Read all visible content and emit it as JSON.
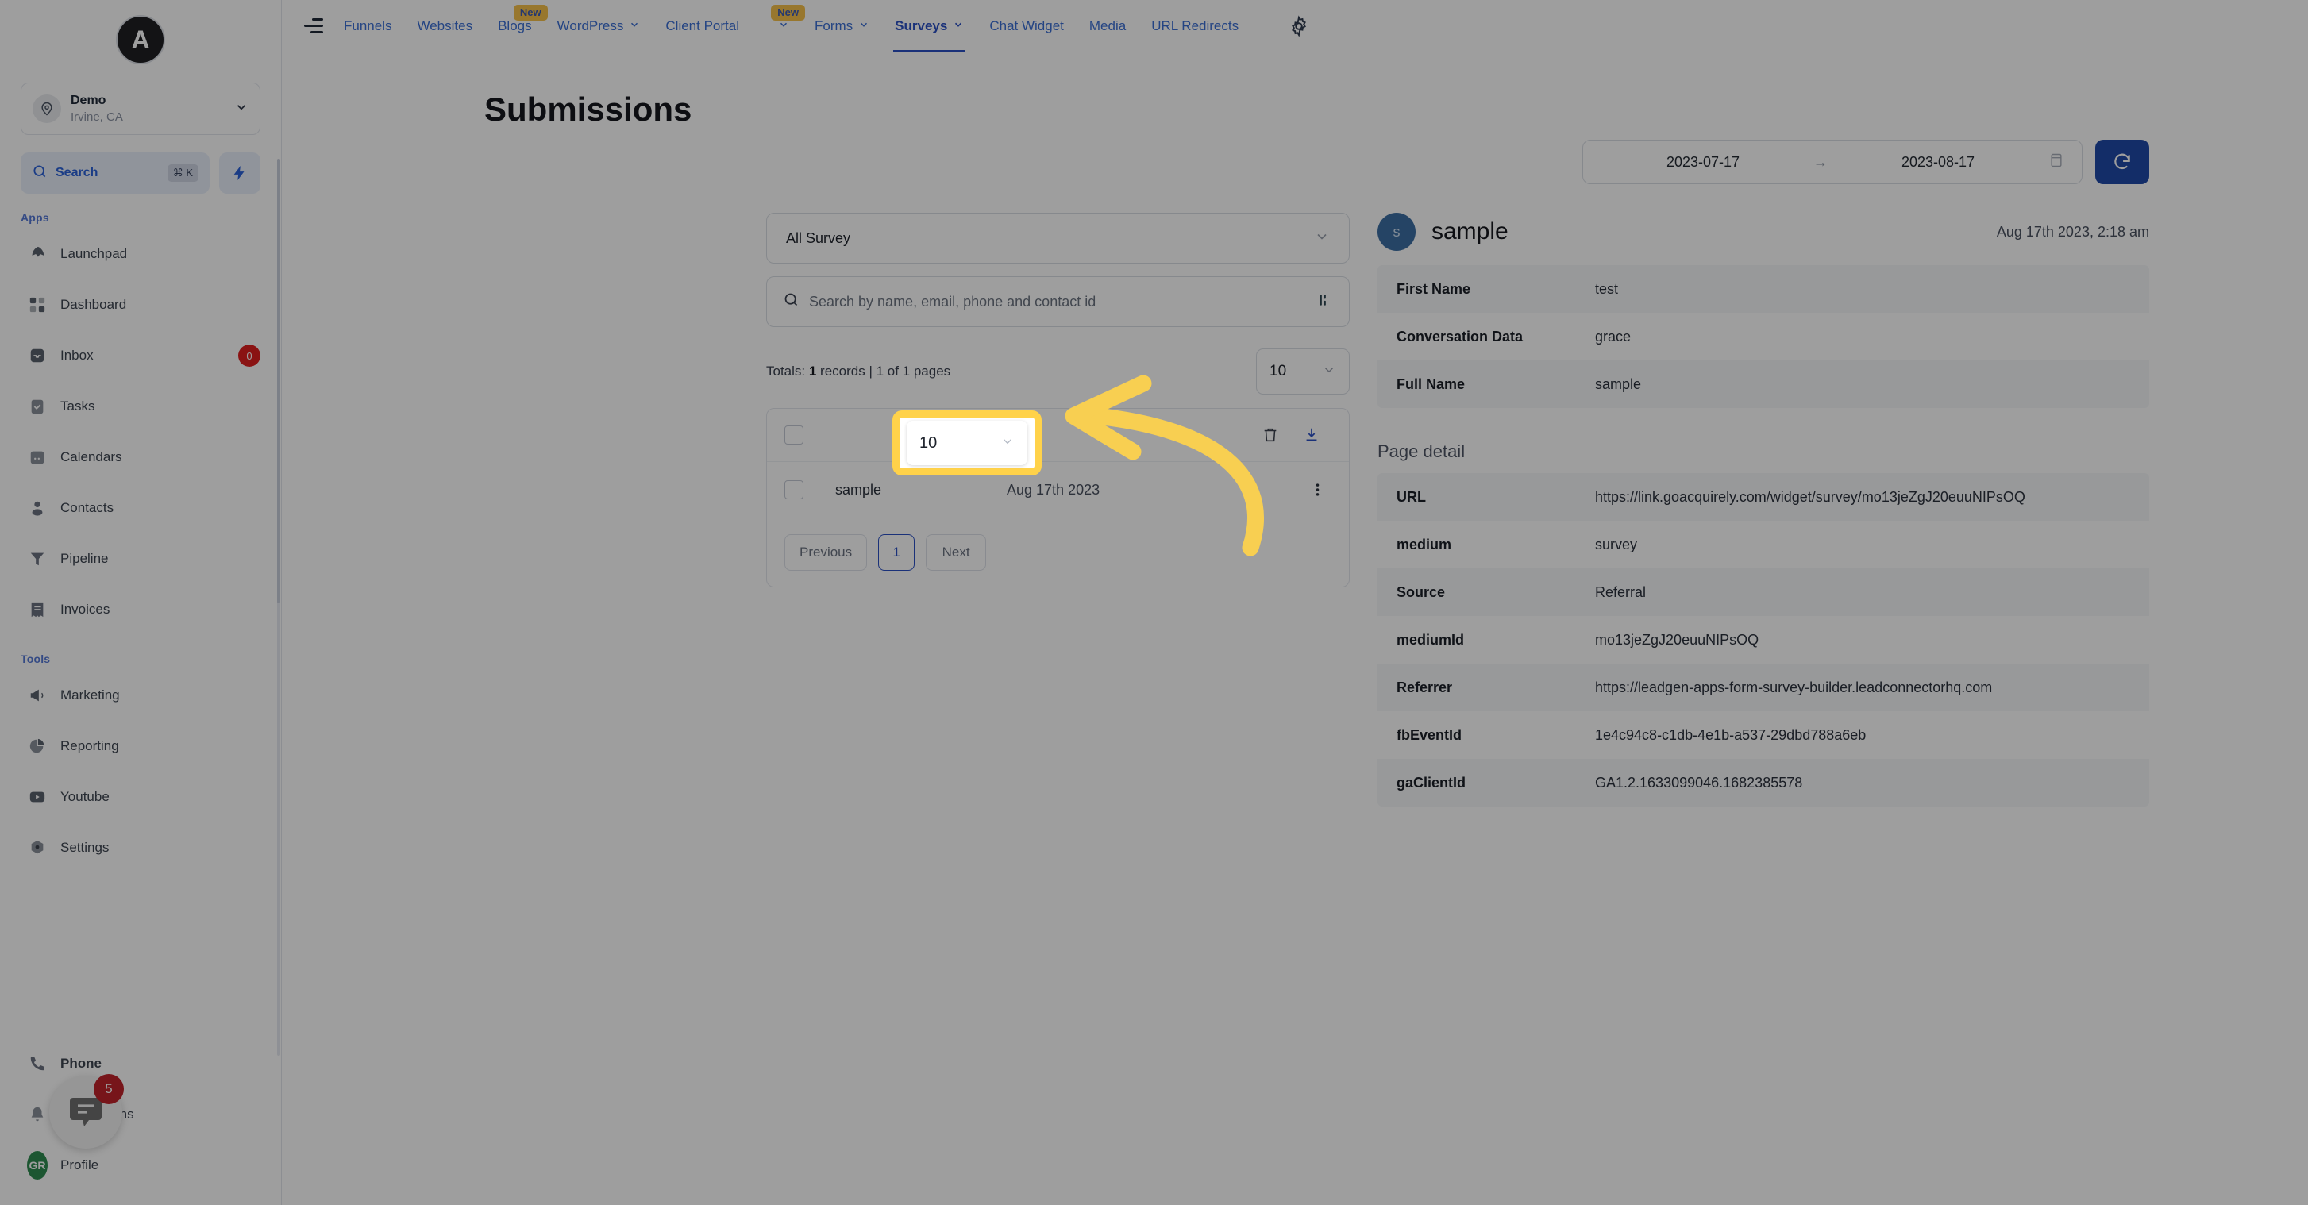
{
  "sidebar": {
    "logo_letter": "A",
    "location": {
      "name": "Demo",
      "sub": "Irvine, CA"
    },
    "search": {
      "label": "Search",
      "shortcut": "⌘ K"
    },
    "sections": [
      {
        "label": "Apps"
      },
      {
        "label": "Tools"
      }
    ],
    "apps_label": "Apps",
    "tools_label": "Tools",
    "apps": [
      {
        "label": "Launchpad",
        "icon": "rocket-icon",
        "badge": ""
      },
      {
        "label": "Dashboard",
        "icon": "grid-icon",
        "badge": ""
      },
      {
        "label": "Inbox",
        "icon": "inbox-icon",
        "badge": "0"
      },
      {
        "label": "Tasks",
        "icon": "clipboard-check-icon",
        "badge": ""
      },
      {
        "label": "Calendars",
        "icon": "calendar-icon",
        "badge": ""
      },
      {
        "label": "Contacts",
        "icon": "user-icon",
        "badge": ""
      },
      {
        "label": "Pipeline",
        "icon": "funnel-icon",
        "badge": ""
      },
      {
        "label": "Invoices",
        "icon": "invoice-icon",
        "badge": ""
      }
    ],
    "tools": [
      {
        "label": "Marketing",
        "icon": "megaphone-icon",
        "badge": ""
      },
      {
        "label": "Reporting",
        "icon": "pie-chart-icon",
        "badge": ""
      },
      {
        "label": "Youtube",
        "icon": "youtube-icon",
        "badge": ""
      },
      {
        "label": "Settings",
        "icon": "gear-icon",
        "badge": ""
      }
    ],
    "bottom": [
      {
        "label": "Phone",
        "icon": "phone-icon",
        "badge": ""
      },
      {
        "label": "Notifications",
        "icon": "bell-icon",
        "badge": ""
      },
      {
        "label": "Profile",
        "icon": "avatar-icon",
        "badge": "",
        "initials": "GR"
      }
    ]
  },
  "topnav": {
    "items": [
      {
        "label": "Funnels",
        "caret": false,
        "badge": "",
        "active": false
      },
      {
        "label": "Websites",
        "caret": false,
        "badge": "",
        "active": false
      },
      {
        "label": "Blogs",
        "caret": false,
        "badge": "New",
        "active": false
      },
      {
        "label": "WordPress",
        "caret": true,
        "badge": "",
        "active": false
      },
      {
        "label": "Client Portal",
        "caret": true,
        "badge": "New",
        "active": false
      },
      {
        "label": "Forms",
        "caret": true,
        "badge": "",
        "active": false
      },
      {
        "label": "Surveys",
        "caret": true,
        "badge": "",
        "active": true
      },
      {
        "label": "Chat Widget",
        "caret": false,
        "badge": "",
        "active": false
      },
      {
        "label": "Media",
        "caret": false,
        "badge": "",
        "active": false
      },
      {
        "label": "URL Redirects",
        "caret": false,
        "badge": "",
        "active": false
      }
    ],
    "settings_icon": "gear-icon"
  },
  "page": {
    "title": "Submissions",
    "date_range": {
      "start": "2023-07-17",
      "end": "2023-08-17",
      "arrow": "→",
      "calendar_icon": "calendar-icon"
    },
    "refresh_icon": "refresh-icon"
  },
  "left_panel": {
    "survey_select": {
      "value": "All Survey",
      "chevron": "chevron-down-icon"
    },
    "search": {
      "placeholder": "Search by name, email, phone and contact id",
      "value": "",
      "icon": "search-icon",
      "filter_icon": "sliders-icon"
    },
    "totals": {
      "prefix": "Totals: ",
      "records": "1",
      "suffix": " records | 1 of 1 pages"
    },
    "per_page": {
      "value": "10",
      "chevron": "chevron-down-icon"
    },
    "actions": {
      "delete_icon": "trash-icon",
      "download_icon": "download-icon"
    },
    "rows": [
      {
        "name": "sample",
        "date": "Aug 17th 2023",
        "menu_icon": "kebab-menu-icon"
      }
    ],
    "pagination": {
      "previous": "Previous",
      "page": "1",
      "next": "Next"
    }
  },
  "detail": {
    "avatar_letter": "s",
    "name": "sample",
    "timestamp": "Aug 17th 2023, 2:18 am",
    "fields": [
      {
        "key": "First Name",
        "value": "test"
      },
      {
        "key": "Conversation Data",
        "value": "grace"
      },
      {
        "key": "Full Name",
        "value": "sample"
      }
    ],
    "page_detail_title": "Page detail",
    "page_detail": [
      {
        "key": "URL",
        "value": "https://link.goacquirely.com/widget/survey/mo13jeZgJ20euuNIPsOQ"
      },
      {
        "key": "medium",
        "value": "survey"
      },
      {
        "key": "Source",
        "value": "Referral"
      },
      {
        "key": "mediumId",
        "value": "mo13jeZgJ20euuNIPsOQ"
      },
      {
        "key": "Referrer",
        "value": "https://leadgen-apps-form-survey-builder.leadconnectorhq.com"
      },
      {
        "key": "fbEventId",
        "value": "1e4c94c8-c1db-4e1b-a537-29dbd788a6eb"
      },
      {
        "key": "gaClientId",
        "value": "GA1.2.1633099046.1682385578"
      }
    ]
  },
  "chat_widget": {
    "badge": "5",
    "icon": "chat-bubble-icon"
  },
  "annotation": {
    "highlight_target": "10",
    "highlight_color": "#ffd24a",
    "arrow_color": "#f8cf51"
  },
  "colors": {
    "accent_blue": "#2a50c4",
    "nav_link": "#3b6fd4",
    "badge_red": "#df1f1f",
    "new_badge": "#f5c14b",
    "highlight_yellow": "#ffd24a"
  }
}
